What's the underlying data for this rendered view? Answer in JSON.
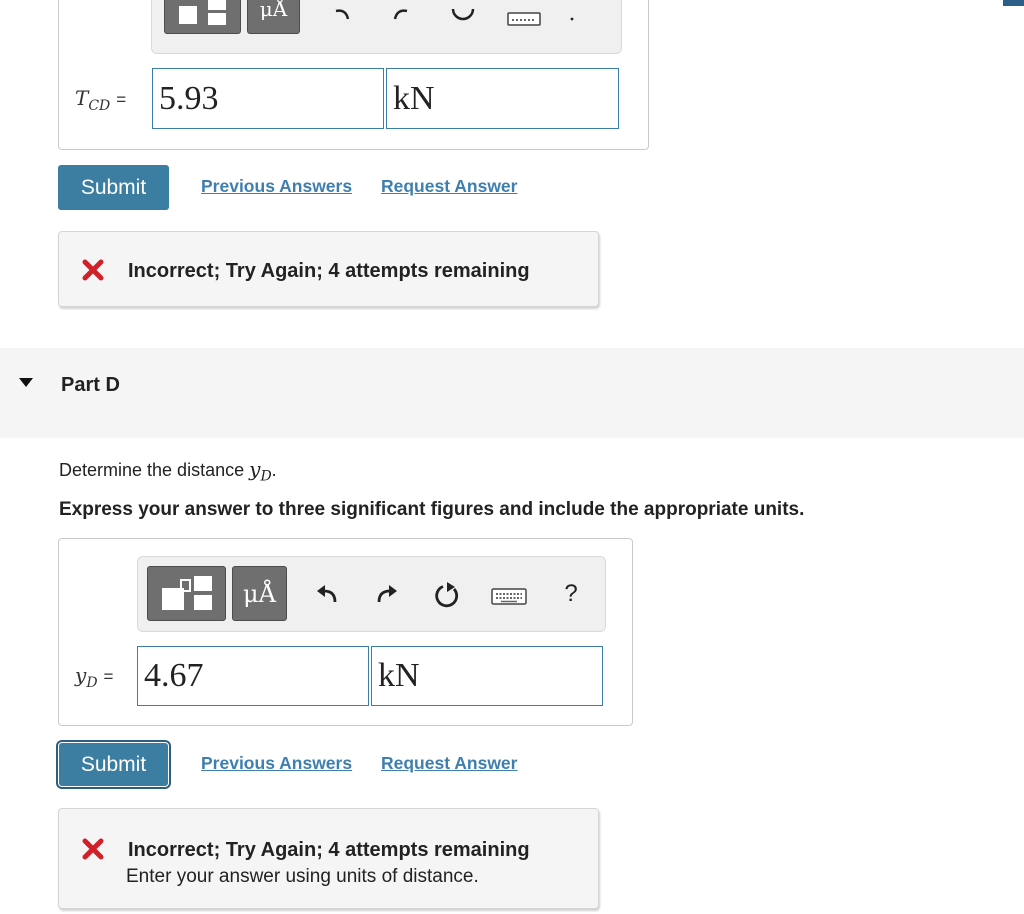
{
  "part_c": {
    "answer": {
      "variable": "T",
      "subscript": "CD",
      "equals": "=",
      "value": "5.93",
      "unit": "kN"
    },
    "toolbar": {
      "symbols_label": "μÅ"
    },
    "submit_label": "Submit",
    "previous_answers_label": "Previous Answers",
    "request_answer_label": "Request Answer",
    "feedback": {
      "title": "Incorrect; Try Again; 4 attempts remaining"
    }
  },
  "part_d": {
    "title": "Part D",
    "question_text": "Determine the distance",
    "question_var": "y",
    "question_sub": "D",
    "question_end": ".",
    "instruction": "Express your answer to three significant figures and include the appropriate units.",
    "toolbar": {
      "symbols_label": "μÅ",
      "help_label": "?"
    },
    "answer": {
      "variable": "y",
      "subscript": "D",
      "equals": "=",
      "value": "4.67",
      "unit": "kN"
    },
    "submit_label": "Submit",
    "previous_answers_label": "Previous Answers",
    "request_answer_label": "Request Answer",
    "feedback": {
      "title": "Incorrect; Try Again; 4 attempts remaining",
      "detail": "Enter your answer using units of distance."
    }
  },
  "icons": {
    "templates": "templates-icon",
    "undo": "undo-icon",
    "redo": "redo-icon",
    "reset": "reset-icon",
    "keyboard": "keyboard-icon",
    "help": "help-icon",
    "incorrect": "x-icon",
    "collapse": "triangle-down-icon",
    "bookmark": "bookmark-icon"
  },
  "colors": {
    "submit": "#3c7ea1",
    "link": "#3f7fb0",
    "incorrect": "#d0202a",
    "input_border": "#3c7ea8"
  }
}
